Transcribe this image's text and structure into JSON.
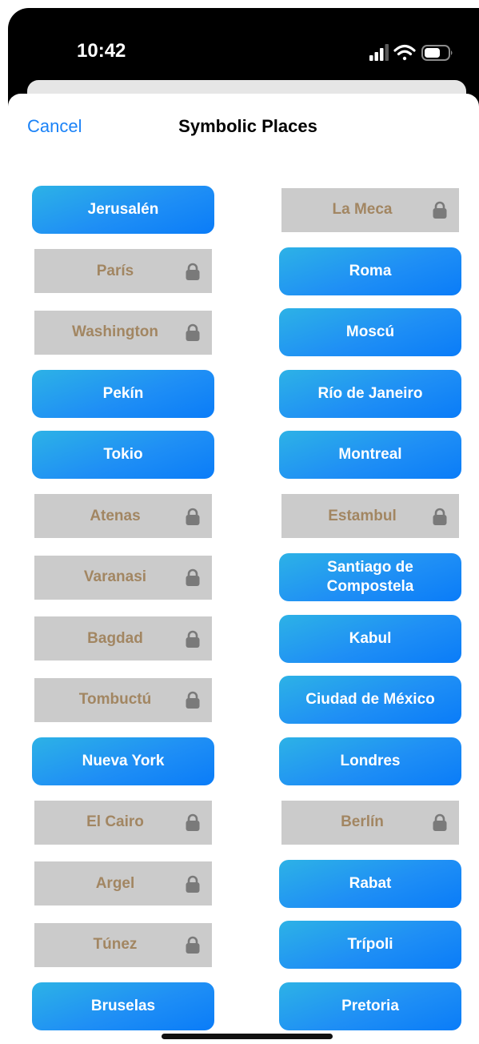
{
  "status_bar": {
    "time": "10:42",
    "icons": [
      "cellular-signal-icon",
      "wifi-icon",
      "battery-icon"
    ]
  },
  "header": {
    "cancel_label": "Cancel",
    "title": "Symbolic Places"
  },
  "colors": {
    "accent": "#1a82f7",
    "unlocked_gradient_start": "#2db2e6",
    "unlocked_gradient_end": "#0a7cf8",
    "locked_background": "#cbcbcb",
    "locked_text": "#a28662",
    "lock_icon": "#7a7a7a"
  },
  "places": {
    "left": [
      {
        "label": "Jerusalén",
        "locked": false
      },
      {
        "label": "París",
        "locked": true
      },
      {
        "label": "Washington",
        "locked": true
      },
      {
        "label": "Pekín",
        "locked": false
      },
      {
        "label": "Tokio",
        "locked": false
      },
      {
        "label": "Atenas",
        "locked": true
      },
      {
        "label": "Varanasi",
        "locked": true
      },
      {
        "label": "Bagdad",
        "locked": true
      },
      {
        "label": "Tombuctú",
        "locked": true
      },
      {
        "label": "Nueva York",
        "locked": false
      },
      {
        "label": "El Cairo",
        "locked": true
      },
      {
        "label": "Argel",
        "locked": true
      },
      {
        "label": "Túnez",
        "locked": true
      },
      {
        "label": "Bruselas",
        "locked": false
      }
    ],
    "right": [
      {
        "label": "La Meca",
        "locked": true
      },
      {
        "label": "Roma",
        "locked": false
      },
      {
        "label": "Moscú",
        "locked": false
      },
      {
        "label": "Río de Janeiro",
        "locked": false
      },
      {
        "label": "Montreal",
        "locked": false
      },
      {
        "label": "Estambul",
        "locked": true
      },
      {
        "label": "Santiago de Compostela",
        "locked": false
      },
      {
        "label": "Kabul",
        "locked": false
      },
      {
        "label": "Ciudad de México",
        "locked": false
      },
      {
        "label": "Londres",
        "locked": false
      },
      {
        "label": "Berlín",
        "locked": true
      },
      {
        "label": "Rabat",
        "locked": false
      },
      {
        "label": "Trípoli",
        "locked": false
      },
      {
        "label": "Pretoria",
        "locked": false
      }
    ]
  }
}
